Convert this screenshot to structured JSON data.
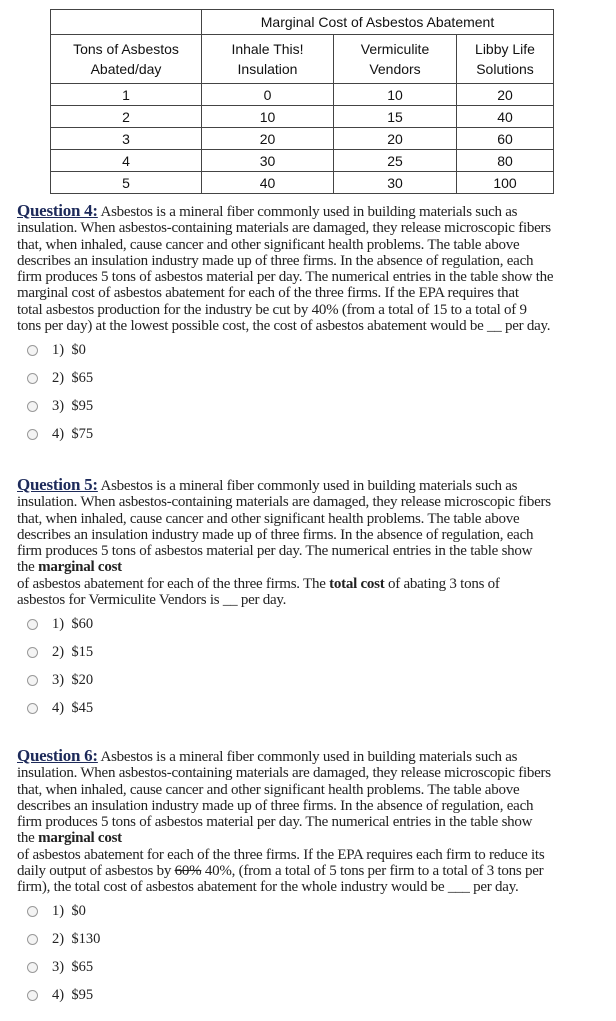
{
  "table": {
    "group_header": "Marginal Cost of Asbestos Abatement",
    "row_header": [
      "Tons of Asbestos",
      "Abated/day"
    ],
    "firms": [
      [
        "Inhale This!",
        "Insulation"
      ],
      [
        "Vermiculite",
        "Vendors"
      ],
      [
        "Libby Life",
        "Solutions"
      ]
    ],
    "rows": [
      [
        "1",
        "0",
        "10",
        "20"
      ],
      [
        "2",
        "10",
        "15",
        "40"
      ],
      [
        "3",
        "20",
        "20",
        "60"
      ],
      [
        "4",
        "30",
        "25",
        "80"
      ],
      [
        "5",
        "40",
        "30",
        "100"
      ]
    ]
  },
  "questions": [
    {
      "title": "Question 4:",
      "lines": [
        [
          {
            "t": " Asbestos is a mineral fiber commonly used in building materials such as"
          }
        ],
        [
          {
            "t": "insulation. When asbestos-containing materials are damaged, they release microscopic fibers"
          }
        ],
        [
          {
            "t": "that, when inhaled, cause cancer and other significant health problems.  The table above"
          }
        ],
        [
          {
            "t": "describes an insulation industry made up of three firms. In the absence of regulation, each"
          }
        ],
        [
          {
            "t": "firm produces 5 tons of asbestos material per day. The numerical entries in the table show the"
          }
        ],
        [
          {
            "t": "marginal cost of asbestos abatement for each of the three firms.   If the EPA requires that"
          }
        ],
        [
          {
            "t": "total asbestos production for the industry be cut by 40% (from a total of 15 to a total of 9"
          }
        ],
        [
          {
            "t": "tons per day) at the lowest possible cost, the cost of asbestos abatement would be __ per day."
          }
        ]
      ],
      "options": [
        "1)  $0",
        "2)  $65",
        "3)  $95",
        "4)  $75"
      ]
    },
    {
      "title": "Question 5:",
      "lines": [
        [
          {
            "t": " Asbestos is a mineral fiber commonly used in building materials such as"
          }
        ],
        [
          {
            "t": "insulation. When asbestos-containing materials are damaged, they release microscopic fibers"
          }
        ],
        [
          {
            "t": "that, when inhaled, cause cancer and other significant health problems.  The table above"
          }
        ],
        [
          {
            "t": "describes an insulation industry made up of three firms. In the absence of regulation, each"
          }
        ],
        [
          {
            "t": "firm produces 5 tons of asbestos material per day. The numerical entries in the table show"
          }
        ],
        [
          {
            "t": "the "
          },
          {
            "t": "marginal cost",
            "b": true
          }
        ],
        [
          {
            "t": "of asbestos abatement for each of the three firms.  The "
          },
          {
            "t": "total cost",
            "b": true
          },
          {
            "t": " of abating 3 tons of"
          }
        ],
        [
          {
            "t": "asbestos for Vermiculite Vendors is __ per day."
          }
        ]
      ],
      "options": [
        "1)  $60",
        "2)  $15",
        "3)  $20",
        "4)  $45"
      ]
    },
    {
      "title": "Question 6:",
      "lines": [
        [
          {
            "t": " Asbestos is a mineral fiber commonly used in building materials such as"
          }
        ],
        [
          {
            "t": "insulation. When asbestos-containing materials are damaged, they release microscopic fibers"
          }
        ],
        [
          {
            "t": "that, when inhaled, cause cancer and other significant health problems.  The table above"
          }
        ],
        [
          {
            "t": "describes an insulation industry made up of three firms. In the absence of regulation, each"
          }
        ],
        [
          {
            "t": "firm produces 5 tons of asbestos material per day. The numerical entries in the table show"
          }
        ],
        [
          {
            "t": "the "
          },
          {
            "t": "marginal cost",
            "b": true
          }
        ],
        [
          {
            "t": "of asbestos abatement for each of the three firms.   If the EPA requires each firm to reduce its"
          }
        ],
        [
          {
            "t": "daily output of asbestos by "
          },
          {
            "t": "60%",
            "s": true
          },
          {
            "t": " 40%, (from a total of 5 tons per firm to a total of 3 tons per"
          }
        ],
        [
          {
            "t": "firm), the total cost of asbestos abatement for the whole industry would be ___ per day."
          }
        ]
      ],
      "options": [
        "1)  $0",
        "2)  $130",
        "3)  $65",
        "4)  $95"
      ]
    }
  ]
}
